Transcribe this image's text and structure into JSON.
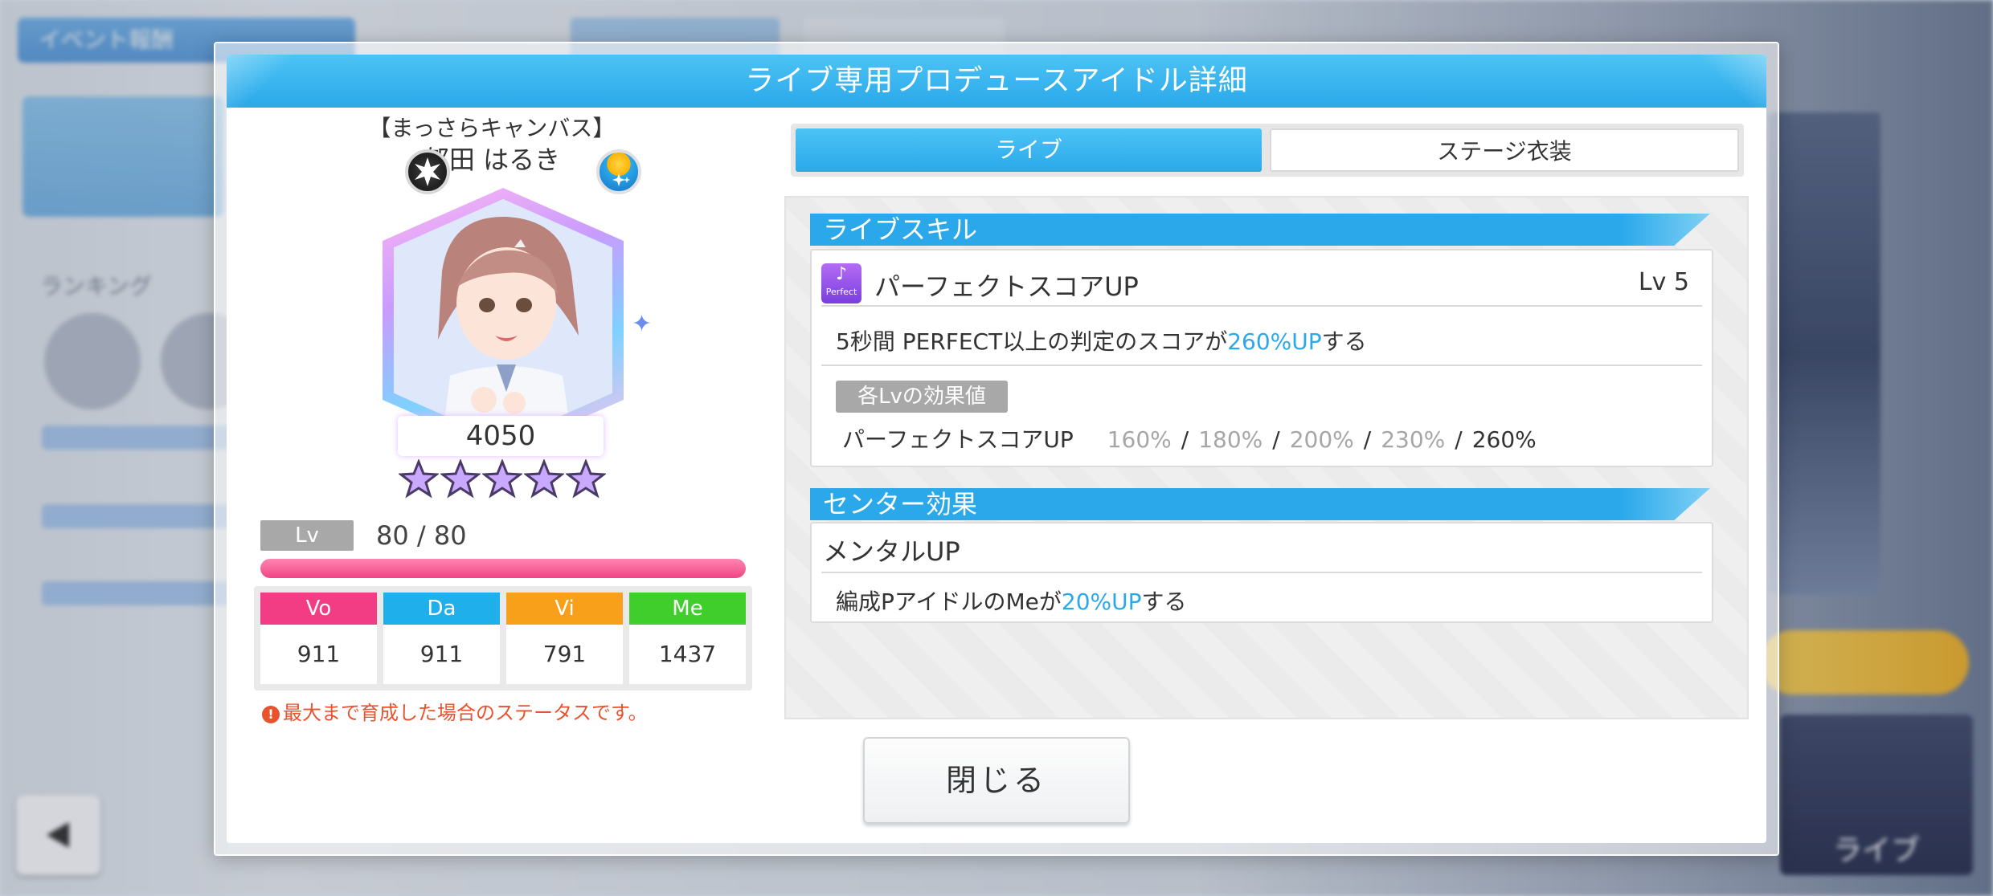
{
  "header": {
    "title": "ライブ専用プロデュースアイドル詳細"
  },
  "idol": {
    "epithet": "【まっさらキャンバス】",
    "name": "郁田 はるき",
    "power": "4050",
    "stars": 5,
    "lv_label": "Lv",
    "lv_value": "80 / 80",
    "lv_progress": 1.0,
    "stats": [
      {
        "label": "Vo",
        "value": "911",
        "color": "#f23c84"
      },
      {
        "label": "Da",
        "value": "911",
        "color": "#1fb0ec"
      },
      {
        "label": "Vi",
        "value": "791",
        "color": "#f8a01a"
      },
      {
        "label": "Me",
        "value": "1437",
        "color": "#3fce2c"
      }
    ],
    "note": "最大まで育成した場合のステータスです。"
  },
  "tabs": [
    {
      "label": "ライブ",
      "active": true
    },
    {
      "label": "ステージ衣装",
      "active": false
    }
  ],
  "live_skill": {
    "section_title": "ライブスキル",
    "icon_text": "Perfect",
    "name": "パーフェクトスコアUP",
    "level": "Lv 5",
    "desc_prefix": "5秒間 PERFECT以上の判定のスコアが",
    "desc_highlight": "260%UP",
    "desc_suffix": "する",
    "effect_tag": "各Lvの効果値",
    "effect_name": "パーフェクトスコアUP",
    "effect_values": [
      "160%",
      "180%",
      "200%",
      "230%",
      "260%"
    ],
    "separator": "/"
  },
  "center_effect": {
    "section_title": "センター効果",
    "name": "メンタルUP",
    "desc_prefix": "編成Pアイドルの Meが",
    "desc_prefix_exact": "編成PアイドルのMeが",
    "desc_highlight": "20%UP",
    "desc_suffix": "する"
  },
  "close_button": {
    "label": "閉じる"
  },
  "background": {
    "event_button": "イベント報酬",
    "ranking": "ランキング",
    "live_button": "ライブ"
  }
}
